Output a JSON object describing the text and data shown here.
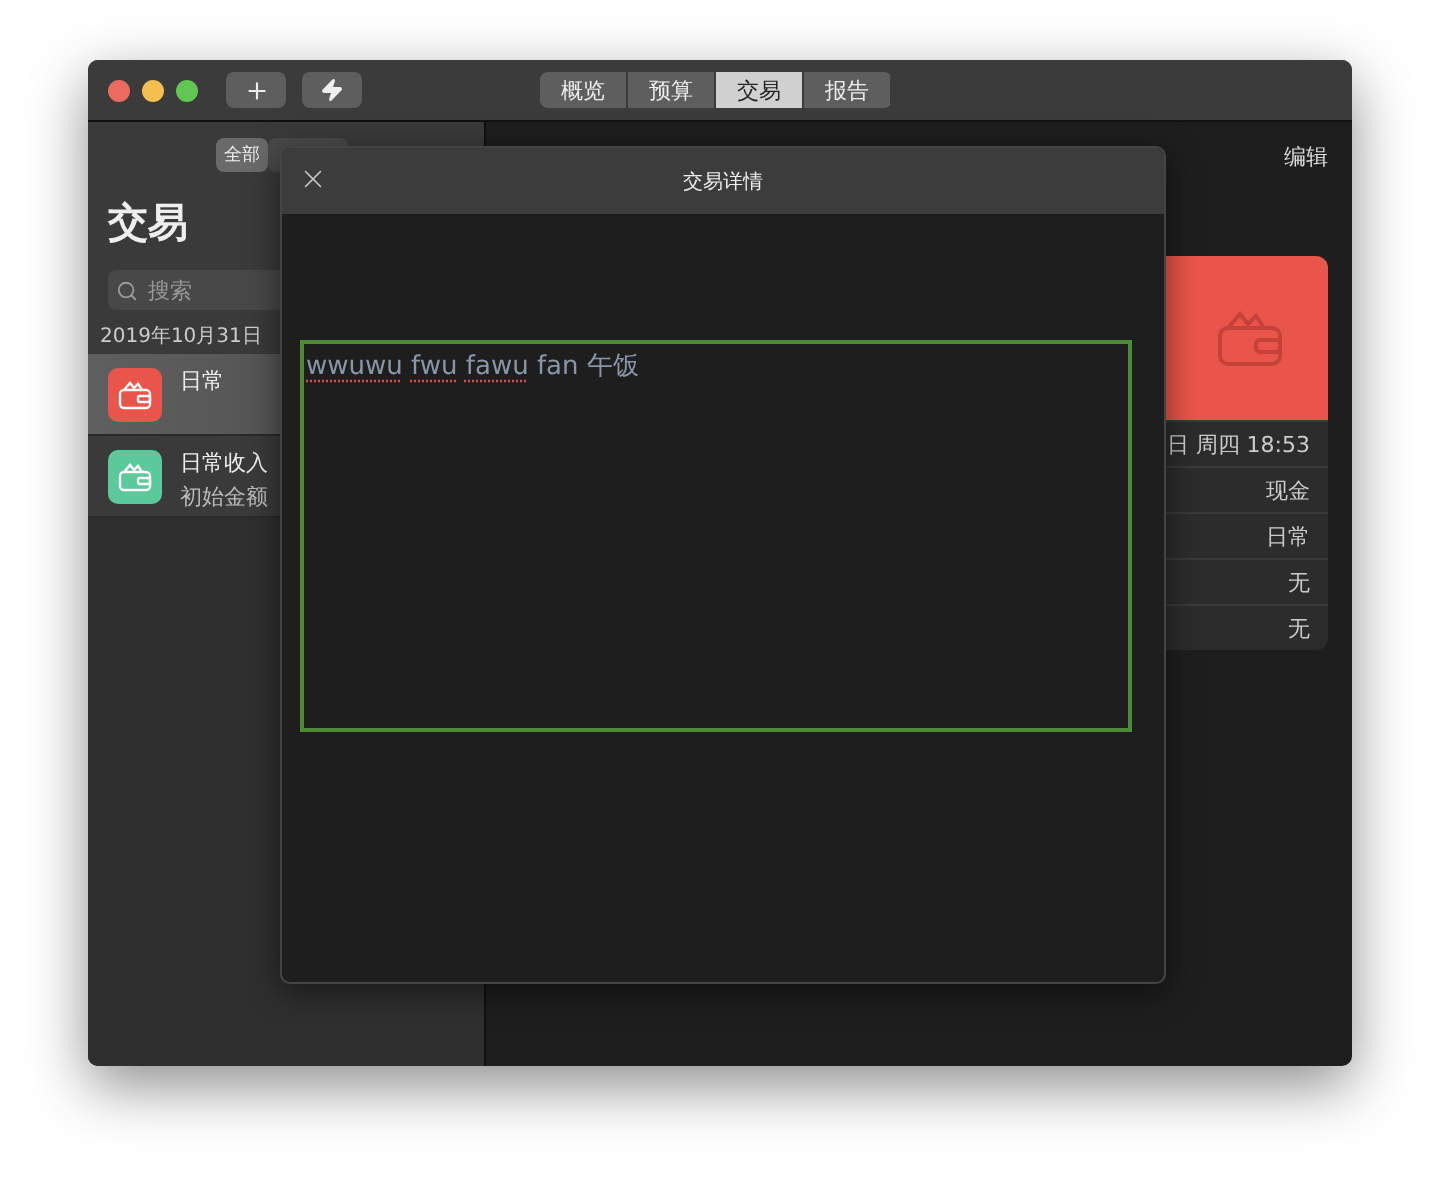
{
  "toolbar": {
    "tabs": [
      {
        "label": "概览",
        "selected": false
      },
      {
        "label": "预算",
        "selected": false
      },
      {
        "label": "交易",
        "selected": true
      },
      {
        "label": "报告",
        "selected": false
      }
    ]
  },
  "sidebar": {
    "filters": [
      {
        "label": "全部",
        "selected": true
      },
      {
        "selected": false
      }
    ],
    "title": "交易",
    "search": {
      "placeholder": "搜索"
    },
    "date_header": "2019年10月31日",
    "transactions": [
      {
        "title": "日常",
        "color": "#e9554a",
        "selected": true
      },
      {
        "title": "日常收入",
        "subtitle": "初始金额",
        "color": "#5bc99a",
        "selected": false
      }
    ]
  },
  "detail": {
    "edit": "编辑",
    "rows": [
      "日 周四 18:53",
      "现金",
      "日常",
      "无",
      "无"
    ]
  },
  "modal": {
    "title": "交易详情",
    "note": [
      {
        "text": "wwuwu",
        "misspelled": true
      },
      {
        "text": "fwu",
        "misspelled": true
      },
      {
        "text": "fawu",
        "misspelled": true
      },
      {
        "text": "fan",
        "misspelled": false
      },
      {
        "text": "午饭",
        "misspelled": false
      }
    ]
  }
}
